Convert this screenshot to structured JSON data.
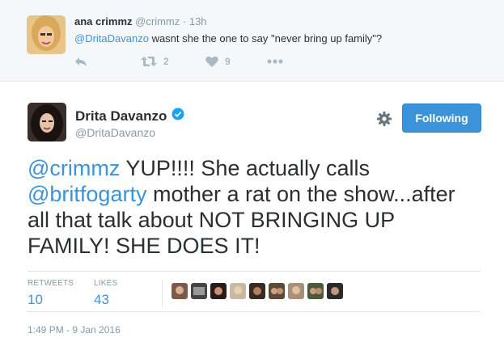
{
  "reply_tweet": {
    "author_name": "ana crimmz",
    "author_handle": "@crimmz",
    "separator": "·",
    "time": "13h",
    "mention": "@DritaDavanzo",
    "text": " wasnt she the one to say \"never bring up family\"?",
    "actions": {
      "reply_icon": "reply-icon",
      "retweet_icon": "retweet-icon",
      "retweet_count": "2",
      "like_icon": "heart-icon",
      "like_count": "9",
      "more_icon": "more-dots-icon"
    }
  },
  "main_tweet": {
    "author_name": "Drita Davanzo",
    "verified_icon": "verified-badge-icon",
    "author_handle": "@DritaDavanzo",
    "settings_icon": "gear-icon",
    "follow_button_label": "Following",
    "text_parts": {
      "mention1": "@crimmz",
      "part1": " YUP!!!! She actually calls ",
      "mention2": "@britfogarty",
      "part2": " mother a rat on the show...after all that talk about NOT BRINGING UP FAMILY! SHE DOES IT!"
    },
    "stats": {
      "retweets_label": "RETWEETS",
      "retweets_value": "10",
      "likes_label": "LIKES",
      "likes_value": "43"
    },
    "timestamp": "1:49 PM - 9 Jan 2016"
  },
  "colors": {
    "link": "#3b94d9",
    "button": "#3b94d9",
    "muted": "#8899a6",
    "reply_bg": "#f5f8fa"
  }
}
